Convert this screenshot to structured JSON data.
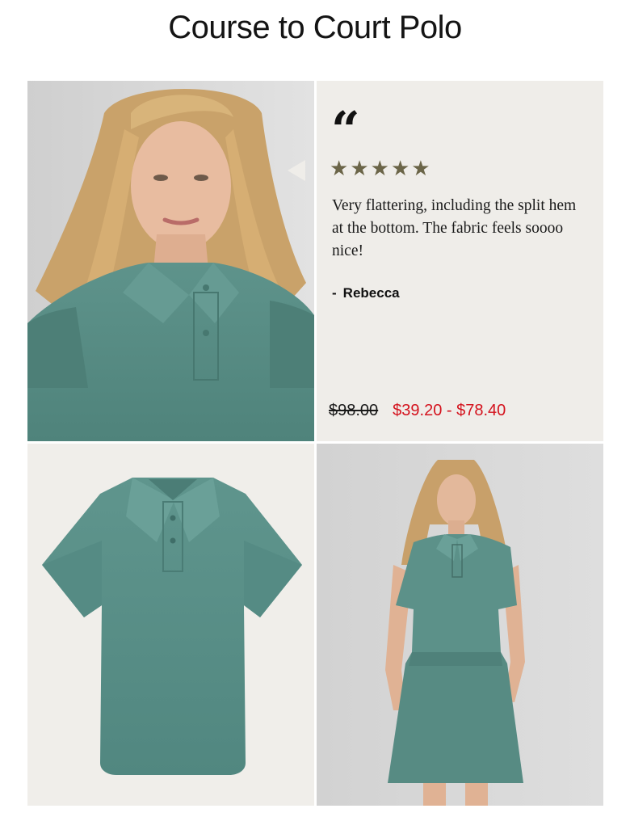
{
  "page": {
    "title": "Course to Court Polo"
  },
  "review": {
    "quote_glyph": "“",
    "stars": [
      "★",
      "★",
      "★",
      "★",
      "★"
    ],
    "rating": 5,
    "text": "Very flattering, including the split hem at the bottom. The fabric feels soooo nice!",
    "dash": "-",
    "author": "Rebecca"
  },
  "pricing": {
    "original": "$98.00",
    "sale": "$39.20 - $78.40"
  },
  "colors": {
    "polo_teal": "#5a8e86",
    "sale_red": "#d4121d",
    "star_olive": "#6b6548",
    "review_bg": "#efede9"
  },
  "images": {
    "model_closeup": "woman-wearing-teal-polo-closeup",
    "product_flat": "teal-polo-flat-lay",
    "model_full": "woman-wearing-teal-polo-and-skirt"
  }
}
